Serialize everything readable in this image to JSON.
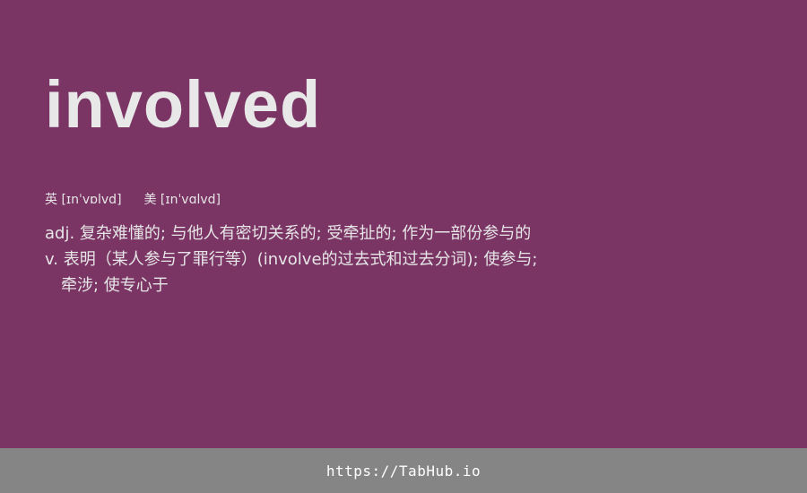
{
  "word": "involved",
  "pronunciation": {
    "uk_label": "英",
    "uk_ipa": "[ɪnˈvɒlvd]",
    "us_label": "美",
    "us_ipa": "[ɪnˈvɑlvd]"
  },
  "definitions": [
    "adj. 复杂难懂的; 与他人有密切关系的; 受牵扯的; 作为一部份参与的",
    "v. 表明（某人参与了罪行等）(involve的过去式和过去分词); 使参与;",
    "牵涉; 使专心于"
  ],
  "footer": {
    "link": "https://TabHub.io"
  },
  "colors": {
    "background": "#7b3565",
    "footer_bar": "#858585",
    "text": "#e6e6e6"
  }
}
